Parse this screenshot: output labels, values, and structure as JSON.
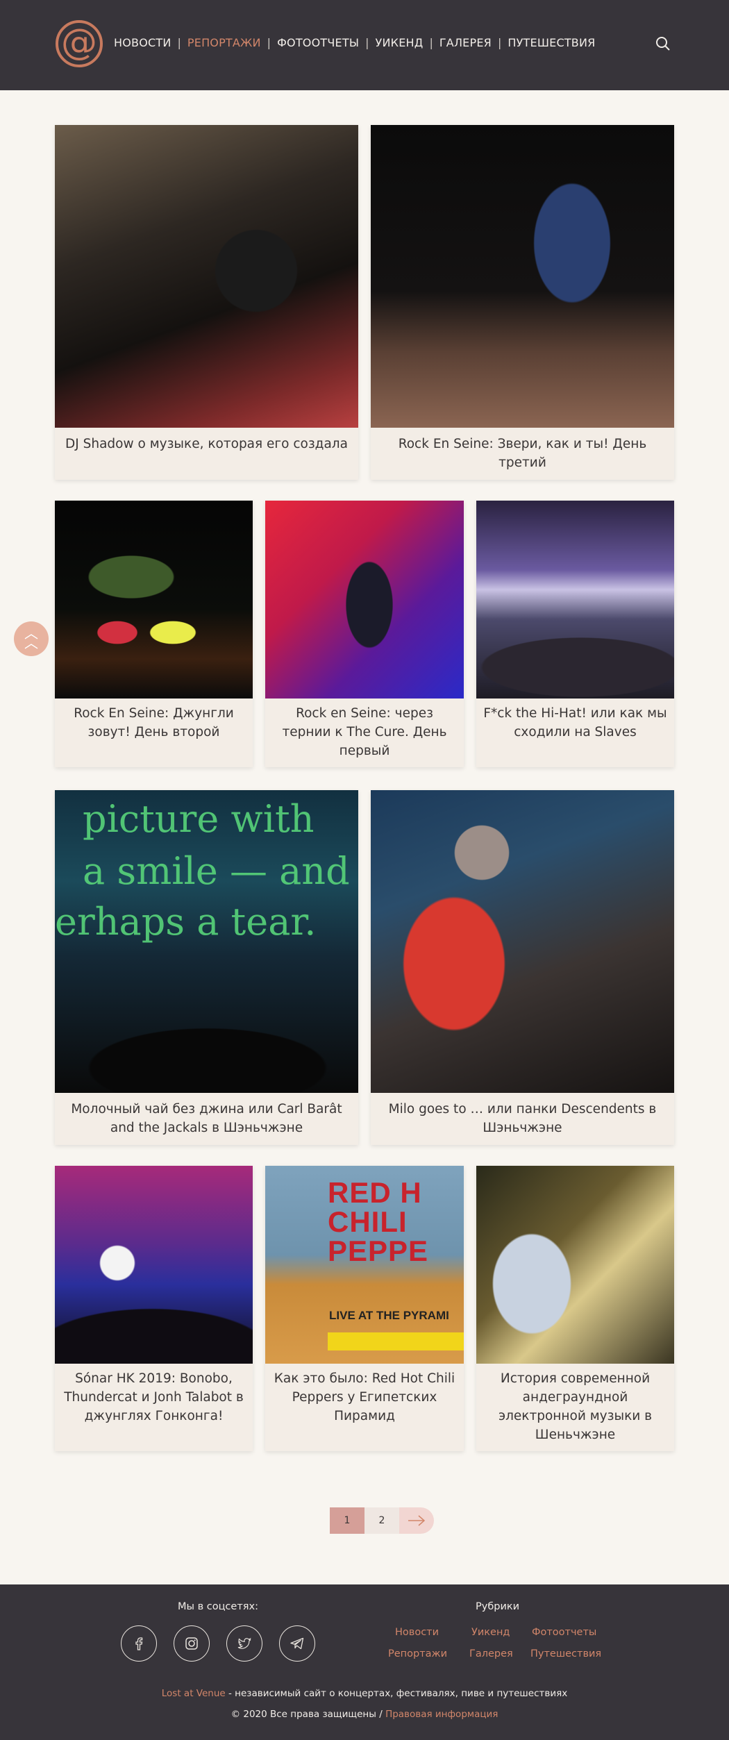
{
  "header": {
    "logo_text": "@",
    "nav": [
      {
        "label": "НОВОСТИ"
      },
      {
        "label": "РЕПОРТАЖИ"
      },
      {
        "label": "ФОТООТЧЕТЫ"
      },
      {
        "label": "УИКЕНД"
      },
      {
        "label": "ГАЛЕРЕЯ"
      },
      {
        "label": "ПУТЕШЕСТВИЯ"
      }
    ],
    "active_index": 1,
    "separator": "|",
    "icons": {
      "search": "search-icon",
      "logo": "at-sign-logo"
    }
  },
  "articles": [
    {
      "title": "DJ Shadow о музыке, которая его создала"
    },
    {
      "title": "Rock En Seine: Звери, как и ты! День третий"
    },
    {
      "title": "Rock En Seine: Джунгли зовут! День второй"
    },
    {
      "title": "Rock en Seine: через тернии к The Cure. День первый"
    },
    {
      "title": "F*ck the Hi-Hat! или как мы сходили на Slaves"
    },
    {
      "title": "Молочный чай без джина или Carl Barât and the Jackals в Шэньчжэне",
      "image_text": [
        "picture with",
        "a smile — and",
        "erhaps a tear."
      ]
    },
    {
      "title": "Milo goes to … или панки Descendents в Шэньчжэне"
    },
    {
      "title": "Sónar HK 2019: Bonobo, Thundercat и Jonh Talabot в джунглях Гонконга!"
    },
    {
      "title": "Как это было: Red Hot Chili Peppers у Египетских Пирамид",
      "image_text": [
        "RED H",
        "CHILI",
        "PEPPE",
        "LIVE AT THE PYRAMI"
      ]
    },
    {
      "title": "История современной андеграундной электронной музыки в Шеньчжэне"
    }
  ],
  "back_to_top": {
    "icon": "double-chevron-up-icon"
  },
  "pagination": {
    "pages": [
      "1",
      "2"
    ],
    "current": "1",
    "next_icon": "arrow-right-icon"
  },
  "footer": {
    "social_heading": "Мы в соцсетях:",
    "social": [
      "facebook-icon",
      "instagram-icon",
      "twitter-icon",
      "telegram-icon"
    ],
    "rubrics_heading": "Рубрики",
    "rubrics": [
      "Новости",
      "Уикенд",
      "Фотоотчеты",
      "Репортажи",
      "Галерея",
      "Путешествия"
    ],
    "site_name": "Lost at Venue",
    "tagline": " - независимый сайт о концертах, фестивалях, пиве и путешествиях",
    "copyright": "© 2020 Все права защищены / ",
    "legal_link": "Правовая информация"
  },
  "colors": {
    "header_bg": "#37343a",
    "accent": "#d2866a",
    "page_bg": "#f8f5f0",
    "card_bg": "#f3ede6"
  }
}
